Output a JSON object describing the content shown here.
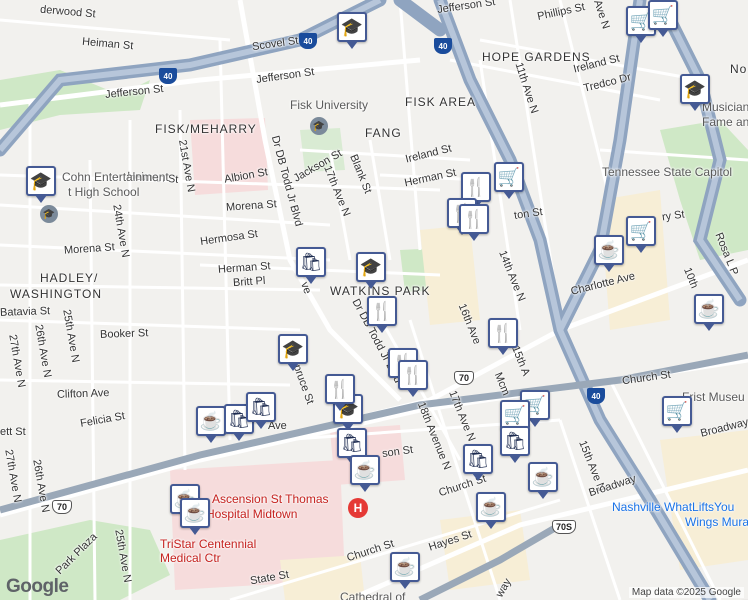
{
  "map": {
    "attribution": "Map data ©2025 Google",
    "logo": "Google",
    "areas": {
      "hope_gardens": "HOPE GARDENS",
      "fisk_area": "FISK AREA",
      "fang": "FANG",
      "fisk_meharry": "FISK/MEHARRY",
      "watkins_park": "WATKINS PARK",
      "hadley_washington_1": "HADLEY/",
      "hadley_washington_2": "WASHINGTON",
      "north_cut": "No"
    },
    "streets": {
      "heiman_1": "Heiman St",
      "heiman_2": "Heiman St",
      "scovel": "Scovel St",
      "jefferson_1": "Jefferson St",
      "jefferson_2": "Jefferson St",
      "jefferson_3": "Jefferson St",
      "phillips": "Phillips St",
      "underwood": "derwood St",
      "ireland_1": "Ireland St",
      "ireland_2": "Ireland St",
      "tredco": "Tredco Dr",
      "herman_1": "Herman St",
      "herman_2": "Herman St",
      "albion": "Albion St",
      "jackson": "Jackson St",
      "blank": "Blank St",
      "ave_17th": "17th Ave N",
      "ave_21st": "21st Ave N",
      "ave_24th": "24th Ave N",
      "ave_25th": "25th Ave N",
      "ave_26th": "26th Ave N",
      "ave_26th_b": "26th Ave N",
      "ave_27th": "27th Ave N",
      "ave_27th_b": "27th Ave N",
      "ave_25th_b": "25th Ave N",
      "ave_11th": "11th Ave N",
      "ave_14th": "14th Ave N",
      "ave_16th": "16th Ave",
      "ave_15th": "15th Ave N",
      "ave_15th_b": "15th A",
      "ave_10th": "10th",
      "ave_17th_b": "17th Ave N",
      "ave_18th": "18th Avenue N",
      "ave_9th": "9th Ave N",
      "morena_1": "Morena St",
      "morena_2": "Morena St",
      "hermosa": "Hermosa St",
      "britt": "Britt Pl",
      "batavia": "Batavia St",
      "booker": "Booker St",
      "clifton": "Clifton Ave",
      "felicia": "Felicia St",
      "ett": "ett St",
      "spruce": "Spruce St",
      "todd_1": "Dr DB Todd Jr Blvd",
      "todd_2": "Dr DB Todd Jr Blvd",
      "todd_3": "Dr DB Todd Jr Blvd",
      "charlotte": "Charlotte Ave",
      "church_1": "Church St",
      "church_2": "Church St",
      "church_3": "Church St",
      "broadway_1": "Broadway",
      "broadway_2": "Broadway",
      "hayes": "Hayes St",
      "state": "State St",
      "park_plaza": "Park Plaza",
      "mcm": "Mcm",
      "ave_fragment": "Ave",
      "ton_st": "ton St",
      "son_st": "son St",
      "ry_st": "ry St",
      "rosa_l_parks": "Rosa L P",
      "way": "way",
      "ve": "ve"
    },
    "pois": {
      "fisk_university": "Fisk University",
      "cohn_1": "Cohn Entertainment",
      "cohn_2": "t High School",
      "tn_capitol": "Tennessee State Capitol",
      "musicians_1": "Musicians",
      "musicians_2": "Fame and M",
      "frist_museum": "Frist Museu",
      "whatlifts": "Nashville WhatLiftsYou",
      "wings": "Wings Mura",
      "ascension_1": "Ascension St Thomas",
      "ascension_2": "Hospital Midtown",
      "tristar_1": "TriStar Centennial",
      "tristar_2": "Medical Ctr",
      "cathedral": "Cathedral of"
    },
    "shields": {
      "i40_a": "40",
      "i40_b": "40",
      "i40_c": "40",
      "i40_d": "40",
      "i40_e": "40",
      "us70_a": "70",
      "us70_b": "70",
      "us70s": "70S"
    },
    "hospital_icon": "H",
    "university_icon": "🎓",
    "markers": [
      {
        "type": "school",
        "glyph": "🎓"
      },
      {
        "type": "grocery",
        "glyph": "🛒"
      },
      {
        "type": "grocery",
        "glyph": "🛒"
      },
      {
        "type": "school",
        "glyph": "🎓"
      },
      {
        "type": "school",
        "glyph": "🎓"
      },
      {
        "type": "restaurant",
        "glyph": "🍴"
      },
      {
        "type": "grocery",
        "glyph": "🛒"
      },
      {
        "type": "restaurant",
        "glyph": "🍴"
      },
      {
        "type": "restaurant",
        "glyph": "🍴"
      },
      {
        "type": "grocery",
        "glyph": "🛒"
      },
      {
        "type": "cafe",
        "glyph": "☕"
      },
      {
        "type": "shopping",
        "glyph": "🛍"
      },
      {
        "type": "school",
        "glyph": "🎓"
      },
      {
        "type": "restaurant",
        "glyph": "🍴"
      },
      {
        "type": "cafe",
        "glyph": "☕"
      },
      {
        "type": "restaurant",
        "glyph": "🍴"
      },
      {
        "type": "school",
        "glyph": "🎓"
      },
      {
        "type": "restaurant",
        "glyph": "🍴"
      },
      {
        "type": "restaurant",
        "glyph": "🍴"
      },
      {
        "type": "cafe",
        "glyph": "☕"
      },
      {
        "type": "shopping",
        "glyph": "🛍"
      },
      {
        "type": "shopping",
        "glyph": "🛍"
      },
      {
        "type": "school",
        "glyph": "🎓"
      },
      {
        "type": "restaurant",
        "glyph": "🍴"
      },
      {
        "type": "grocery",
        "glyph": "🛒"
      },
      {
        "type": "grocery",
        "glyph": "🛒"
      },
      {
        "type": "shopping",
        "glyph": "🛍"
      },
      {
        "type": "shopping",
        "glyph": "🛍"
      },
      {
        "type": "shopping",
        "glyph": "🛍"
      },
      {
        "type": "cafe",
        "glyph": "☕"
      },
      {
        "type": "cafe",
        "glyph": "☕"
      },
      {
        "type": "cafe",
        "glyph": "☕"
      },
      {
        "type": "cafe",
        "glyph": "☕"
      },
      {
        "type": "cafe",
        "glyph": "☕"
      },
      {
        "type": "cafe",
        "glyph": "☕"
      },
      {
        "type": "cafe",
        "glyph": "☕"
      },
      {
        "type": "grocery",
        "glyph": "🛒"
      }
    ]
  }
}
